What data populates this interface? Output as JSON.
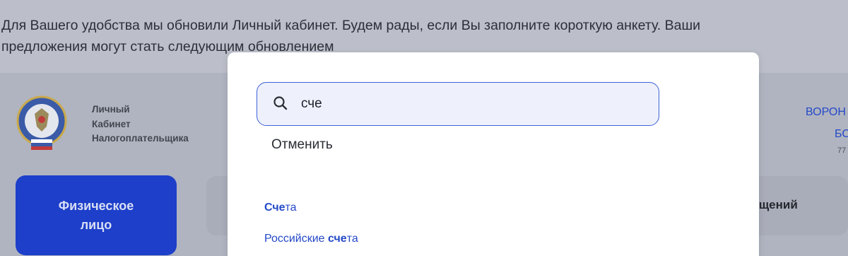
{
  "banner": {
    "text": "Для Вашего удобства мы обновили Личный кабинет. Будем рады, если Вы заполните короткую анкету. Ваши предложения могут стать следующим обновлением"
  },
  "brand": {
    "line1": "Личный",
    "line2": "Кабинет",
    "line3": "Налогоплательщика",
    "logo_icon": "fns-emblem-icon"
  },
  "user": {
    "name_line1": "ВОРОН",
    "name_line2": "БС",
    "inn_partial": "77"
  },
  "nav": {
    "person_line1": "Физическое",
    "person_line2": "лицо",
    "tab_partial": "ращений"
  },
  "search": {
    "value": "сче",
    "icon": "search-icon",
    "cancel_label": "Отменить"
  },
  "suggestions": [
    {
      "bold": "Сче",
      "rest": "та",
      "prefix": ""
    },
    {
      "prefix": "Российские ",
      "bold": "сче",
      "rest": "та"
    }
  ],
  "colors": {
    "accent": "#2449c8",
    "button": "#1d3fc9",
    "overlay": "#b0b4c0"
  }
}
